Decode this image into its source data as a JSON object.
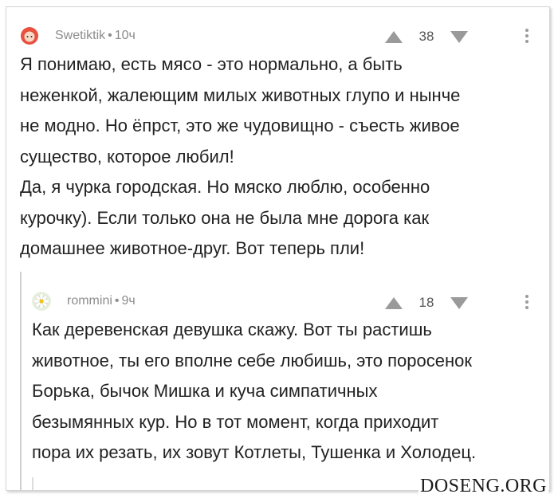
{
  "comments": [
    {
      "username": "Swetiktik",
      "time": "10ч",
      "score": "38",
      "avatar_icon": "red-character-avatar",
      "lines": [
        "Я понимаю, есть мясо - это нормально, а быть",
        "неженкой, жалеющим милых животных глупо и нынче",
        "не модно. Но ёпрст, это же чудовищно - съесть живое",
        "существо, которое любил!",
        "Да, я чурка городская. Но мяско люблю, особенно",
        "курочку). Если только она не была мне дорога как",
        "домашнее животное-друг. Вот теперь пли!"
      ]
    },
    {
      "username": "rommini",
      "time": "9ч",
      "score": "18",
      "avatar_icon": "daisy-flower-avatar",
      "lines": [
        "Как деревенская девушка скажу. Вот ты растишь",
        "животное, ты его вполне себе любишь, это поросенок",
        "Борька, бычок Мишка и куча симпатичных",
        "безымянных кур. Но в тот момент, когда приходит",
        "пора их резать, их зовут Котлеты, Тушенка и Холодец."
      ]
    }
  ],
  "separator": "•",
  "watermark": "DOSENG.ORG",
  "colors": {
    "meta": "#8c8c8c",
    "text": "#222222",
    "avatar1": "#d93a3a"
  }
}
